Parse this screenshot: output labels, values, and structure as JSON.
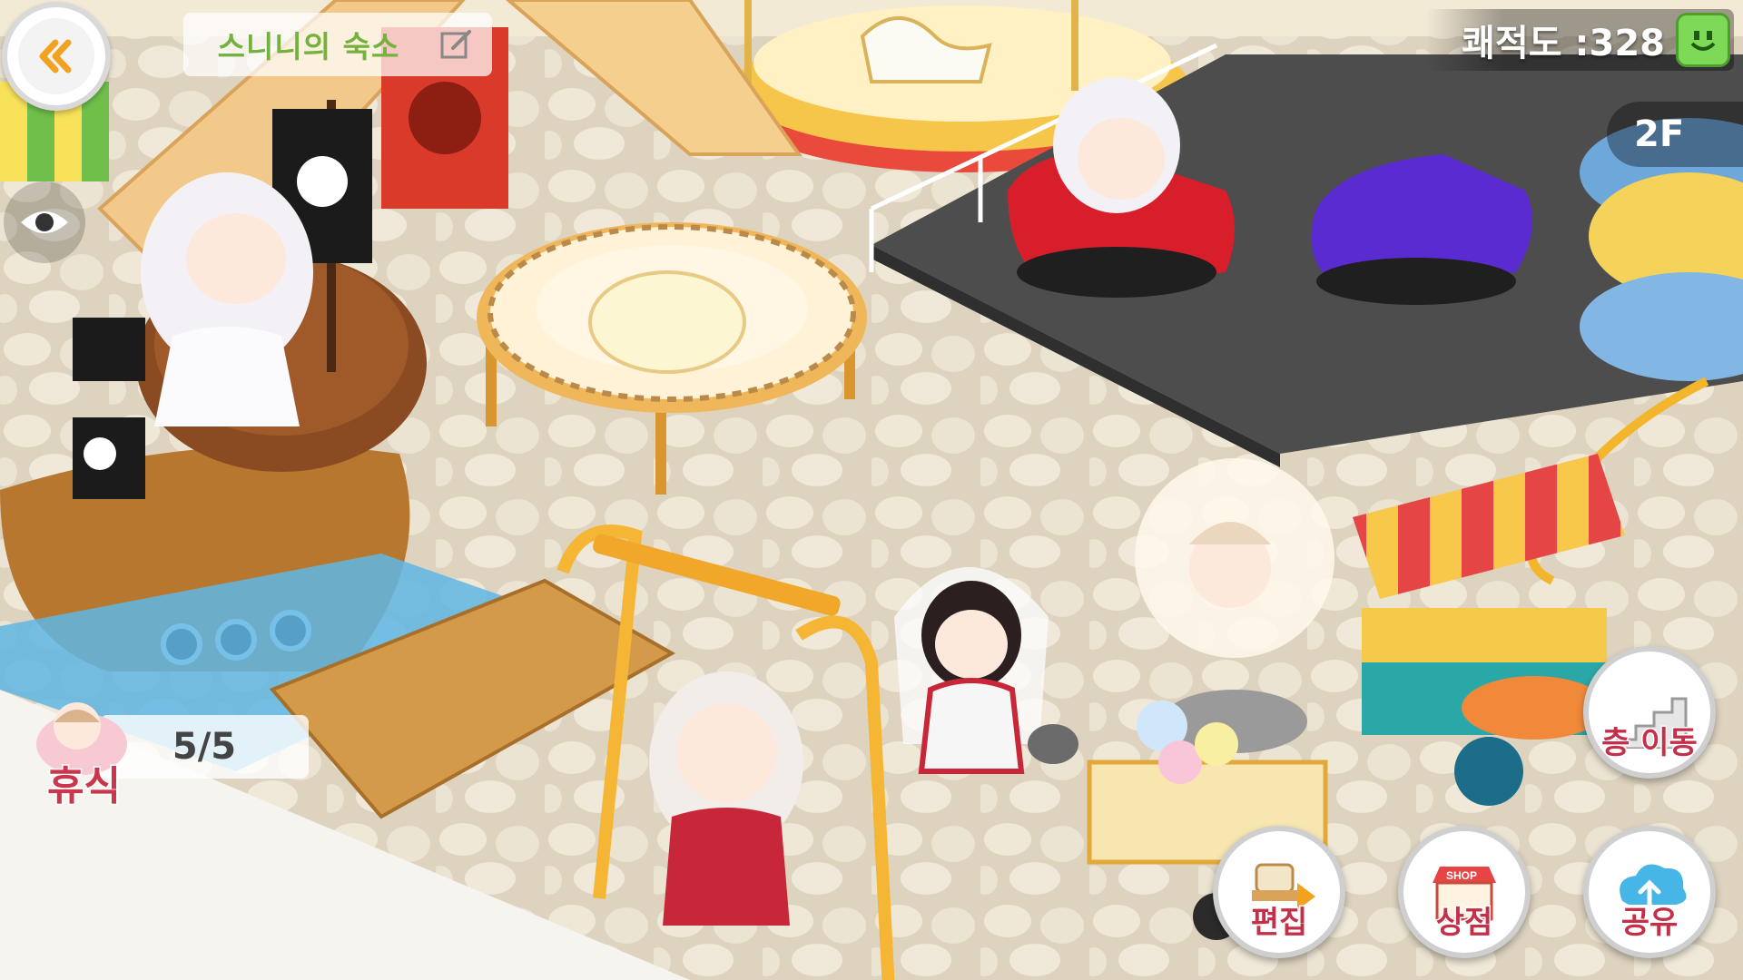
{
  "header": {
    "dorm_title": "스니니의 숙소",
    "back_icon": "back-arrow-icon",
    "edit_icon": "pencil-icon"
  },
  "status": {
    "comfort_label": "쾌적도 :328",
    "comfort_icon": "smile-face-icon",
    "floor": "2F"
  },
  "rest": {
    "label": "휴식",
    "count": "5/5"
  },
  "actions": {
    "floor_move": "층 이동",
    "edit": "편집",
    "shop": "상점",
    "shop_sign": "SHOP",
    "share": "공유"
  },
  "colors": {
    "title_green": "#74b23d",
    "button_red": "#c4304a",
    "comfort_icon_green": "#7ed957"
  }
}
